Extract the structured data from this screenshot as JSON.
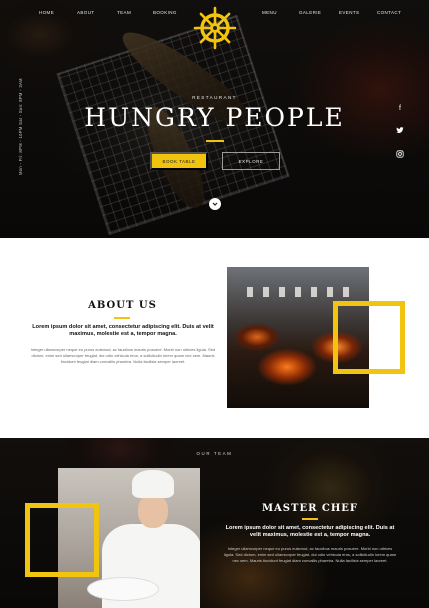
{
  "nav": {
    "left": [
      "HOME",
      "ABOUT",
      "TEAM",
      "BOOKING"
    ],
    "right": [
      "MENU",
      "GALERIE",
      "EVENTS",
      "CONTACT"
    ]
  },
  "hero": {
    "side_hours": "Mon - Fri: 8PM - 10PM   Sat - Sun: 8PM - 3AM",
    "eyebrow": "RESTAURANT",
    "title": "HUNGRY PEOPLE",
    "book_button": "BOOK TABLE",
    "explore_button": "EXPLORE",
    "social": [
      "facebook-icon",
      "twitter-icon",
      "instagram-icon"
    ]
  },
  "about": {
    "title": "ABOUT US",
    "lead": "Lorem ipsum dolor sit amet, consectetur adipiscing elit. Duis at velit maximus, molestie est a, tempor magna.",
    "body": "Integer ullamcorper neque eu purus euismod, ac faucibus mauris posuere. Morbi non ultrices ligula. Sed dictum, enim sed ullamcorper feugiat, dui odio vehicula eros, a sollicitudin lorem quam nec sem. Mauris tincidunt feugiat diam convallis pharetra. Nulla facilisis semper laoreet."
  },
  "chef": {
    "eyebrow": "OUR TEAM",
    "title": "MASTER CHEF",
    "lead": "Lorem ipsum dolor sit amet, consectetur adipiscing elit. Duis at velit maximus, molestie est a, tempor magna.",
    "body": "Integer ullamcorper neque eu purus euismod, ac faucibus mauris posuere. Morbi non ultrices ligula. Sed dictum, enim sed ullamcorper feugiat, dui odio vehicula eros, a sollicitudin lorem quam nec sem. Mauris tincidunt feugiat diam convallis pharetra. Nulla facilisis semper laoreet."
  },
  "colors": {
    "accent": "#f1c40f",
    "dark": "#111111",
    "light": "#ffffff"
  }
}
